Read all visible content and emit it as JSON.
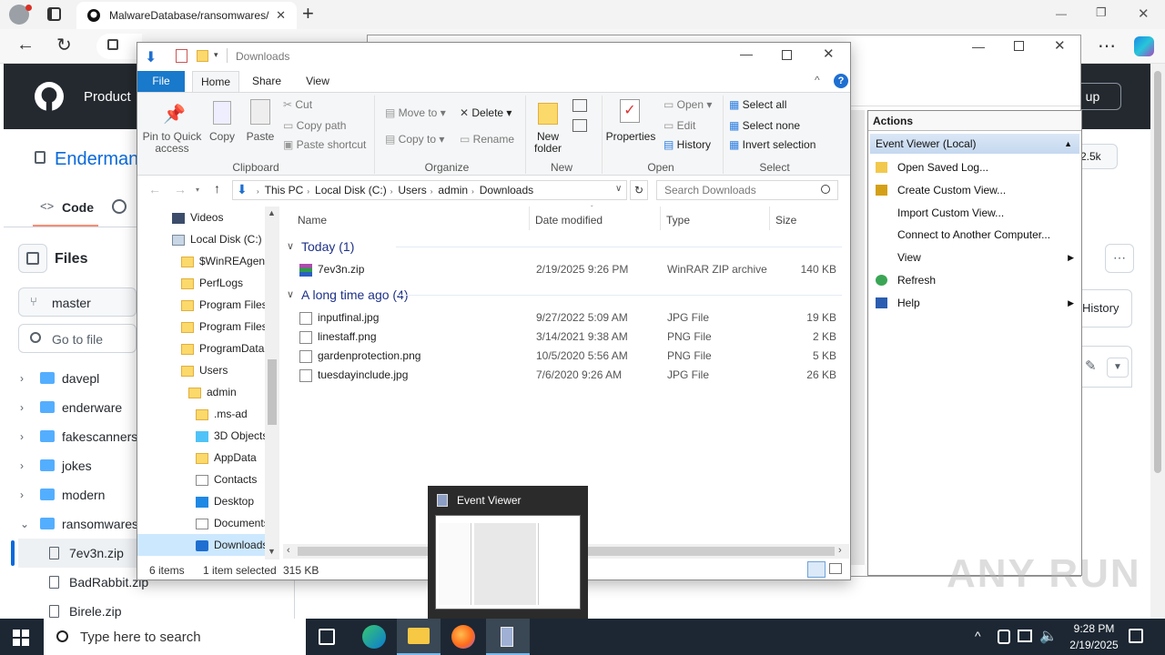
{
  "browser": {
    "tab_title": "MalwareDatabase/ransomwares/",
    "new_tab": "+",
    "window_min": "—",
    "window_restore": "❐",
    "window_close": "✕",
    "more": "⋯"
  },
  "github": {
    "product": "Product",
    "repo_name": "Endermanc",
    "sign_up": "n up",
    "stars": "2.5k",
    "tab_code": "Code",
    "files_title": "Files",
    "branch": "master",
    "go_to_file": "Go to file",
    "history": "History",
    "tree": [
      {
        "name": "davepl",
        "type": "folder"
      },
      {
        "name": "enderware",
        "type": "folder"
      },
      {
        "name": "fakescanners",
        "type": "folder"
      },
      {
        "name": "jokes",
        "type": "folder"
      },
      {
        "name": "modern",
        "type": "folder"
      },
      {
        "name": "ransomwares",
        "type": "folder-open"
      },
      {
        "name": "7ev3n.zip",
        "type": "file"
      },
      {
        "name": "BadRabbit.zip",
        "type": "file"
      },
      {
        "name": "Birele.zip",
        "type": "file"
      }
    ]
  },
  "explorer": {
    "title": "Downloads",
    "tabs": [
      "File",
      "Home",
      "Share",
      "View"
    ],
    "ribbon": {
      "pin": "Pin to Quick access",
      "copy": "Copy",
      "paste": "Paste",
      "cut": "Cut",
      "copy_path": "Copy path",
      "paste_shortcut": "Paste shortcut",
      "clipboard": "Clipboard",
      "move_to": "Move to",
      "copy_to": "Copy to",
      "delete": "Delete",
      "rename": "Rename",
      "organize": "Organize",
      "new_folder": "New folder",
      "new": "New",
      "properties": "Properties",
      "open": "Open",
      "edit": "Edit",
      "history": "History",
      "open_group": "Open",
      "select_all": "Select all",
      "select_none": "Select none",
      "invert_selection": "Invert selection",
      "select_group": "Select"
    },
    "breadcrumb": [
      "This PC",
      "Local Disk (C:)",
      "Users",
      "admin",
      "Downloads"
    ],
    "search_placeholder": "Search Downloads",
    "nav": [
      {
        "name": "Videos",
        "indent": 0
      },
      {
        "name": "Local Disk (C:)",
        "indent": 0
      },
      {
        "name": "$WinREAgent",
        "indent": 1
      },
      {
        "name": "PerfLogs",
        "indent": 1
      },
      {
        "name": "Program Files",
        "indent": 1
      },
      {
        "name": "Program Files",
        "indent": 1
      },
      {
        "name": "ProgramData",
        "indent": 1
      },
      {
        "name": "Users",
        "indent": 1
      },
      {
        "name": "admin",
        "indent": 2
      },
      {
        "name": ".ms-ad",
        "indent": 3
      },
      {
        "name": "3D Objects",
        "indent": 3
      },
      {
        "name": "AppData",
        "indent": 3
      },
      {
        "name": "Contacts",
        "indent": 3
      },
      {
        "name": "Desktop",
        "indent": 3
      },
      {
        "name": "Documents",
        "indent": 3
      },
      {
        "name": "Downloads",
        "indent": 3
      }
    ],
    "columns": [
      "Name",
      "Date modified",
      "Type",
      "Size"
    ],
    "groups": [
      {
        "label": "Today (1)",
        "files": [
          {
            "name": "7ev3n.zip",
            "date": "2/19/2025 9:26 PM",
            "type": "WinRAR ZIP archive",
            "size": "140 KB"
          }
        ]
      },
      {
        "label": "A long time ago (4)",
        "files": [
          {
            "name": "inputfinal.jpg",
            "date": "9/27/2022 5:09 AM",
            "type": "JPG File",
            "size": "19 KB"
          },
          {
            "name": "linestaff.png",
            "date": "3/14/2021 9:38 AM",
            "type": "PNG File",
            "size": "2 KB"
          },
          {
            "name": "gardenprotection.png",
            "date": "10/5/2020 5:56 AM",
            "type": "PNG File",
            "size": "5 KB"
          },
          {
            "name": "tuesdayinclude.jpg",
            "date": "7/6/2020 9:26 AM",
            "type": "JPG File",
            "size": "26 KB"
          }
        ]
      }
    ],
    "status_items": "6 items",
    "status_selected": "1 item selected",
    "status_size": "315 KB"
  },
  "eventviewer": {
    "actions_title": "Actions",
    "section": "Event Viewer (Local)",
    "actions": [
      {
        "label": "Open Saved Log...",
        "sub": false
      },
      {
        "label": "Create Custom View...",
        "sub": false
      },
      {
        "label": "Import Custom View...",
        "sub": false
      },
      {
        "label": "Connect to Another Computer...",
        "sub": false
      },
      {
        "label": "View",
        "sub": true
      },
      {
        "label": "Refresh",
        "sub": false
      },
      {
        "label": "Help",
        "sub": true
      }
    ]
  },
  "taskbar": {
    "search_placeholder": "Type here to search",
    "time": "9:28 PM",
    "date": "2/19/2025",
    "preview_title": "Event Viewer"
  },
  "watermark": "ANY RUN"
}
